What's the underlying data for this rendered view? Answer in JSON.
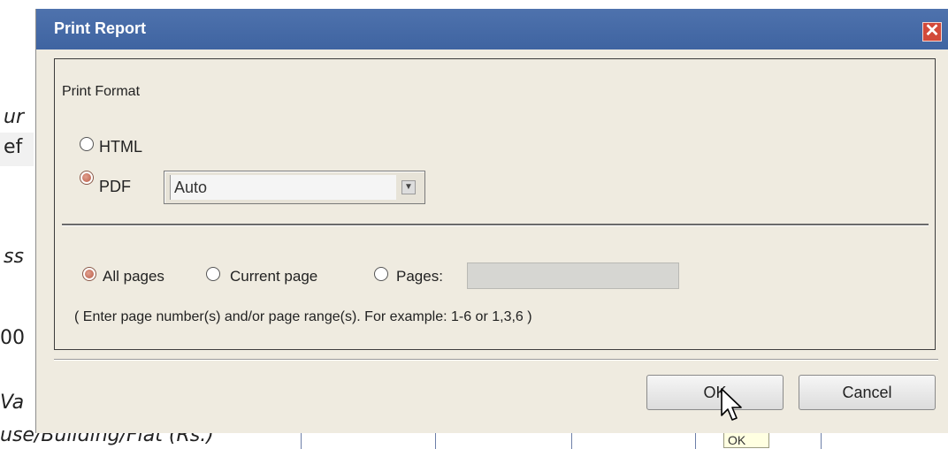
{
  "background": {
    "fragments": [
      "ur",
      "ef",
      "ss",
      "00",
      "Va",
      "use/Building/Flat (Rs.)"
    ],
    "tooltip_text": "OK"
  },
  "dialog": {
    "title": "Print Report",
    "close_glyph": "✕",
    "print_format": {
      "label": "Print Format",
      "options": [
        {
          "label": "HTML",
          "selected": false
        },
        {
          "label": "PDF",
          "selected": true
        }
      ],
      "pdf_mode": {
        "value": "Auto",
        "arrow_glyph": "▼"
      }
    },
    "page_range": {
      "options": [
        {
          "label": "All pages",
          "selected": true
        },
        {
          "label": "Current page",
          "selected": false
        },
        {
          "label": "Pages:",
          "selected": false
        }
      ],
      "pages_value": "",
      "hint": "( Enter page number(s) and/or page range(s). For example: 1-6 or 1,3,6 )"
    },
    "buttons": {
      "ok": "OK",
      "cancel": "Cancel"
    }
  },
  "colors": {
    "titlebar": "#4469a5",
    "dialog_bg": "#efebe0",
    "radio_selected": "#b85a45"
  }
}
